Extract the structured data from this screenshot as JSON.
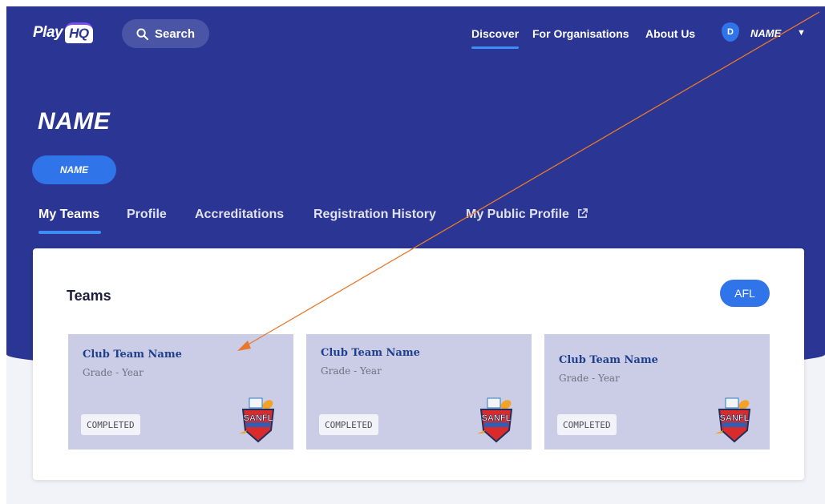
{
  "brand": {
    "logo_play": "Play",
    "logo_hq": "HQ"
  },
  "search": {
    "label": "Search"
  },
  "nav": {
    "discover": "Discover",
    "organisations": "For Organisations",
    "about": "About Us"
  },
  "user": {
    "initial": "D",
    "name": "NAME"
  },
  "page": {
    "title": "NAME",
    "chip": "NAME"
  },
  "tabs": [
    {
      "label": "My Teams"
    },
    {
      "label": "Profile"
    },
    {
      "label": "Accreditations"
    },
    {
      "label": "Registration History"
    },
    {
      "label": "My Public Profile"
    }
  ],
  "teams": {
    "heading": "Teams",
    "filter": "AFL",
    "items": [
      {
        "name": "Club Team Name",
        "grade": "Grade - Year",
        "status": "COMPLETED",
        "logo_text": "SANFL"
      },
      {
        "name": "Club Team Name",
        "grade": "Grade - Year",
        "status": "COMPLETED",
        "logo_text": "SANFL"
      },
      {
        "name": "Club Team Name",
        "grade": "Grade - Year",
        "status": "COMPLETED",
        "logo_text": "SANFL"
      }
    ]
  },
  "colors": {
    "hero": "#2b3593",
    "accent": "#2f74e8",
    "tile": "#cbcde6",
    "annotation_arrow": "#e8792c"
  }
}
